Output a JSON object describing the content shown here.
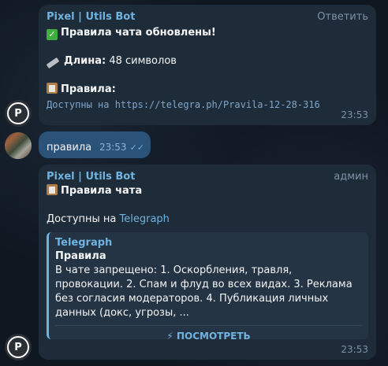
{
  "messages": {
    "m1": {
      "sender": "Pixel | Utils Bot",
      "action": "Ответить",
      "line1": "Правила чата обновлены!",
      "length_label": "Длина:",
      "length_value": "48 символов",
      "rules_label": "Правила:",
      "rules_link": "Доступны на https://telegra.ph/Pravila-12-28-316",
      "time": "23:53",
      "avatar_letter": "P"
    },
    "m2": {
      "text": "правила",
      "time": "23:53"
    },
    "m3": {
      "sender": "Pixel | Utils Bot",
      "role": "админ",
      "title": "Правила чата",
      "available_prefix": "Доступны на",
      "available_link": "Telegraph",
      "preview": {
        "site": "Telegraph",
        "title": "Правила",
        "description": "В чате запрещено: 1. Оскорбления, травля, провокации. 2. Спам и флуд во всех видах. 3. Реклама без согласия модераторов. 4. Публикация личных данных (докс, угрозы, ...",
        "button": "⚡ ПОСМОТРЕТЬ"
      },
      "time": "23:53",
      "avatar_letter": "P"
    }
  },
  "colors": {
    "background": "#0e1621",
    "incoming_bubble": "#1e2c3a",
    "outgoing_bubble": "#2b5278",
    "accent": "#6fb3e0"
  },
  "icons": [
    "check-icon",
    "ruler-icon",
    "clipboard-icon",
    "double-check-icon",
    "lightning-icon"
  ]
}
